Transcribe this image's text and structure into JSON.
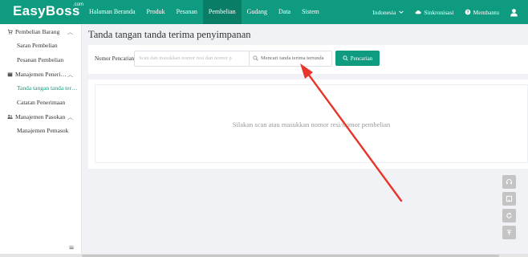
{
  "header": {
    "logo": "EasyBoss",
    "logo_suffix": ".com",
    "nav": [
      "Halaman Beranda",
      "Produk",
      "Pesanan",
      "Pembelian",
      "Gudang",
      "Data",
      "Sistem"
    ],
    "active_nav": "Pembelian",
    "language": "Indonesia",
    "sync": "Sinkronisasi",
    "help": "Membantu"
  },
  "sidebar": {
    "groups": [
      {
        "label": "Pembelian Barang",
        "icon": "cart-icon",
        "items": [
          "Saran Pembelian",
          "Pesanan Pembelian"
        ]
      },
      {
        "label": "Manajemen Peneri…",
        "icon": "box-icon",
        "items": [
          "Tanda tangan tanda ter…",
          "Catatan Penerimaan"
        ]
      },
      {
        "label": "Manajemen Pasokan",
        "icon": "supplier-icon",
        "items": [
          "Manajemen Pemasok"
        ]
      }
    ],
    "active_item": "Tanda tangan tanda ter…"
  },
  "main": {
    "title": "Tanda tangan tanda terima penyimpanan",
    "search": {
      "label": "Nomor Pencarian",
      "placeholder": "Scan dan masukkan nomor resi dan nomor p",
      "select_text": "Mencari tanda terima tertunda",
      "button": "Pencarian"
    },
    "empty_message": "Silakan scan atau masukkan nomor resi/nomor pembelian"
  },
  "colors": {
    "brand": "#0e9b7f",
    "brand_dark": "#0a7d66",
    "annotation": "#e8342b"
  },
  "tools": [
    "headset-icon",
    "book-icon",
    "refresh-icon",
    "upload-icon"
  ]
}
